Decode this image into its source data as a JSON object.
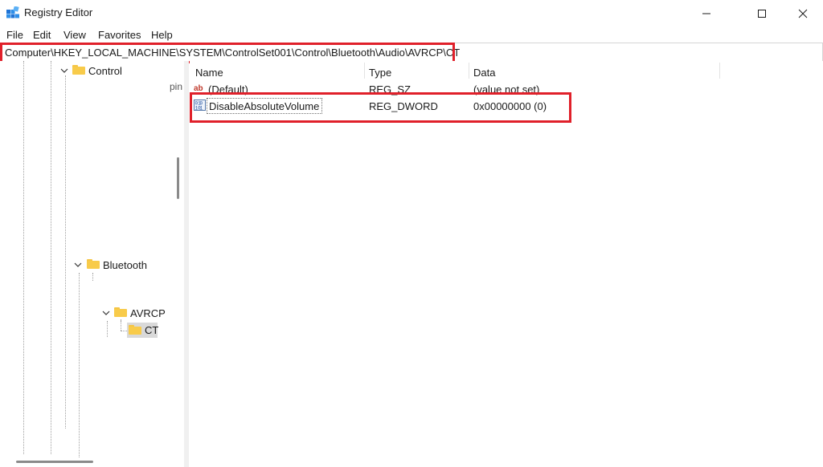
{
  "window": {
    "title": "Registry Editor",
    "icon": "registry-editor-icon",
    "controls": [
      "minimize-icon",
      "maximize-icon",
      "close-icon"
    ]
  },
  "menu": [
    "File",
    "Edit",
    "View",
    "Favorites",
    "Help"
  ],
  "address": {
    "path": "Computer\\HKEY_LOCAL_MACHINE\\SYSTEM\\ControlSet001\\Control\\Bluetooth\\Audio\\AVRCP\\CT"
  },
  "tree": {
    "control": "Control",
    "bluetooth": "Bluetooth",
    "avrcp": "AVRCP",
    "ct": "CT",
    "truncated_fragment": "pin"
  },
  "list": {
    "columns": [
      "Name",
      "Type",
      "Data"
    ],
    "rows": [
      {
        "name": "(Default)",
        "type": "REG_SZ",
        "data": "(value not set)",
        "icon": "string-value-icon"
      },
      {
        "name": "DisableAbsoluteVolume",
        "type": "REG_DWORD",
        "data": "0x00000000 (0)",
        "icon": "dword-value-icon"
      }
    ]
  },
  "colors": {
    "highlight": "#e0202a",
    "folder": "#f8cb4a",
    "selection": "#d9d9d9"
  }
}
